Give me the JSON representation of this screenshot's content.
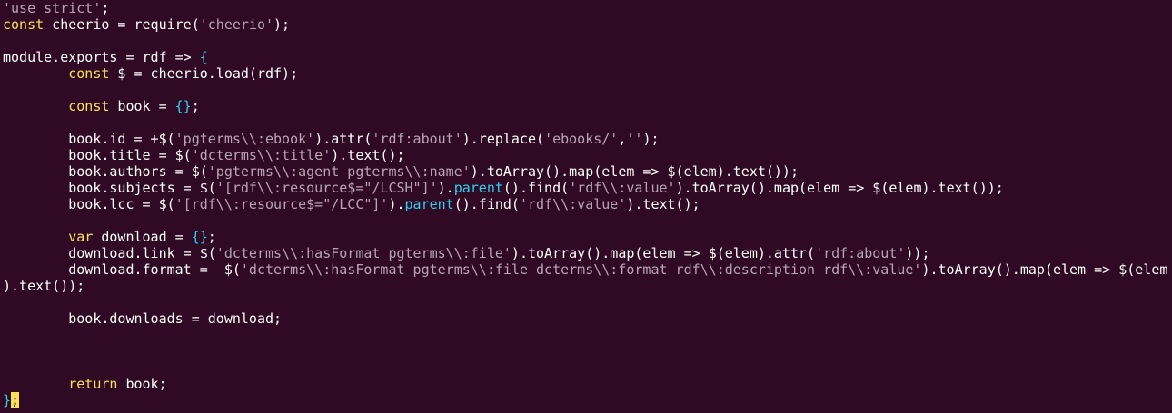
{
  "editor": {
    "colors": {
      "background": "#300a24",
      "keyword": "#f7e155",
      "string": "#b8a4b4",
      "brace": "#2fd0f0",
      "plain": "#ffffff",
      "cursor": "#f7e155"
    },
    "lines": [
      [
        {
          "t": "string",
          "v": "'use strict'"
        },
        {
          "t": "plain",
          "v": ";"
        }
      ],
      [
        {
          "t": "keyword",
          "v": "const"
        },
        {
          "t": "plain",
          "v": " cheerio = require("
        },
        {
          "t": "string",
          "v": "'cheerio'"
        },
        {
          "t": "plain",
          "v": ");"
        }
      ],
      [],
      [
        {
          "t": "plain",
          "v": "module.exports = rdf => "
        },
        {
          "t": "brace",
          "v": "{"
        }
      ],
      [
        {
          "t": "plain",
          "v": "        "
        },
        {
          "t": "keyword",
          "v": "const"
        },
        {
          "t": "plain",
          "v": " $ = cheerio.load(rdf);"
        }
      ],
      [],
      [
        {
          "t": "plain",
          "v": "        "
        },
        {
          "t": "keyword",
          "v": "const"
        },
        {
          "t": "plain",
          "v": " book = "
        },
        {
          "t": "brace",
          "v": "{}"
        },
        {
          "t": "plain",
          "v": ";"
        }
      ],
      [],
      [
        {
          "t": "plain",
          "v": "        book.id = +$("
        },
        {
          "t": "string",
          "v": "'pgterms\\\\:ebook'"
        },
        {
          "t": "plain",
          "v": ").attr("
        },
        {
          "t": "string",
          "v": "'rdf:about'"
        },
        {
          "t": "plain",
          "v": ").replace("
        },
        {
          "t": "string",
          "v": "'ebooks/'"
        },
        {
          "t": "plain",
          "v": ","
        },
        {
          "t": "string",
          "v": "''"
        },
        {
          "t": "plain",
          "v": ");"
        }
      ],
      [
        {
          "t": "plain",
          "v": "        book.title = $("
        },
        {
          "t": "string",
          "v": "'dcterms\\\\:title'"
        },
        {
          "t": "plain",
          "v": ").text();"
        }
      ],
      [
        {
          "t": "plain",
          "v": "        book.authors = $("
        },
        {
          "t": "string",
          "v": "'pgterms\\\\:agent pgterms\\\\:name'"
        },
        {
          "t": "plain",
          "v": ").toArray().map(elem => $(elem).text());"
        }
      ],
      [
        {
          "t": "plain",
          "v": "        book.subjects = $("
        },
        {
          "t": "string",
          "v": "'[rdf\\\\:resource$=\"/LCSH\"]'"
        },
        {
          "t": "plain",
          "v": ")."
        },
        {
          "t": "brace",
          "v": "parent"
        },
        {
          "t": "plain",
          "v": "().find("
        },
        {
          "t": "string",
          "v": "'rdf\\\\:value'"
        },
        {
          "t": "plain",
          "v": ").toArray().map(elem => $(elem).text());"
        }
      ],
      [
        {
          "t": "plain",
          "v": "        book.lcc = $("
        },
        {
          "t": "string",
          "v": "'[rdf\\\\:resource$=\"/LCC\"]'"
        },
        {
          "t": "plain",
          "v": ")."
        },
        {
          "t": "brace",
          "v": "parent"
        },
        {
          "t": "plain",
          "v": "().find("
        },
        {
          "t": "string",
          "v": "'rdf\\\\:value'"
        },
        {
          "t": "plain",
          "v": ").text();"
        }
      ],
      [],
      [
        {
          "t": "plain",
          "v": "        "
        },
        {
          "t": "keyword",
          "v": "var"
        },
        {
          "t": "plain",
          "v": " download = "
        },
        {
          "t": "brace",
          "v": "{}"
        },
        {
          "t": "plain",
          "v": ";"
        }
      ],
      [
        {
          "t": "plain",
          "v": "        download.link = $("
        },
        {
          "t": "string",
          "v": "'dcterms\\\\:hasFormat pgterms\\\\:file'"
        },
        {
          "t": "plain",
          "v": ").toArray().map(elem => $(elem).attr("
        },
        {
          "t": "string",
          "v": "'rdf:about'"
        },
        {
          "t": "plain",
          "v": "));"
        }
      ],
      [
        {
          "t": "plain",
          "v": "        download.format =  $("
        },
        {
          "t": "string",
          "v": "'dcterms\\\\:hasFormat pgterms\\\\:file dcterms\\\\:format rdf\\\\:description rdf\\\\:value'"
        },
        {
          "t": "plain",
          "v": ").toArray().map(elem => $(elem"
        }
      ],
      [
        {
          "t": "plain",
          "v": ").text());"
        }
      ],
      [],
      [
        {
          "t": "plain",
          "v": "        book.downloads = download;"
        }
      ],
      [],
      [],
      [],
      [
        {
          "t": "plain",
          "v": "        "
        },
        {
          "t": "keyword",
          "v": "return"
        },
        {
          "t": "plain",
          "v": " book;"
        }
      ],
      [
        {
          "t": "brace",
          "v": "}"
        },
        {
          "t": "cursor",
          "v": ";"
        }
      ]
    ]
  }
}
